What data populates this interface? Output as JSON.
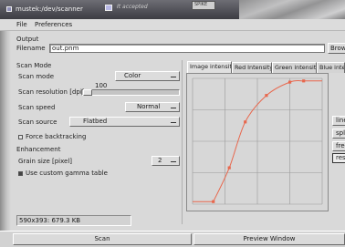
{
  "window": {
    "title": "mustek:/dev/scanner",
    "background_text": "It accepted",
    "background_card": "SPIKE"
  },
  "menu": [
    "File",
    "Preferences"
  ],
  "output": {
    "section": "Output",
    "filename_label": "Filename",
    "filename_value": "out.pnm",
    "browse_label": "Browse"
  },
  "scan_mode": {
    "section": "Scan Mode",
    "mode_label": "Scan mode",
    "mode_value": "Color",
    "resolution_label": "Scan resolution [dpi]",
    "resolution_value": "100",
    "speed_label": "Scan speed",
    "speed_value": "Normal",
    "source_label": "Scan source",
    "source_value": "Flatbed",
    "force_backtracking_label": "Force backtracking",
    "force_backtracking_checked": false
  },
  "enhancement": {
    "section": "Enhancement",
    "grain_label": "Grain size [pixel]",
    "grain_value": "2",
    "gamma_label": "Use custom gamma table",
    "gamma_checked": true
  },
  "tabs": [
    {
      "label": "Image intensity",
      "active": true
    },
    {
      "label": "Red Intensity",
      "active": false
    },
    {
      "label": "Green intensity",
      "active": false
    },
    {
      "label": "Blue intensity",
      "active": false
    }
  ],
  "curve_controls": [
    {
      "label": "linear",
      "selected": false
    },
    {
      "label": "spline",
      "selected": false
    },
    {
      "label": "free",
      "selected": false
    },
    {
      "label": "reset",
      "selected": true
    }
  ],
  "status": {
    "info": "590x393: 679.3 KB"
  },
  "actions": {
    "scan_label": "Scan",
    "preview_label": "Preview Window"
  },
  "colors": {
    "curve": "#e8674d",
    "grid": "#9a9a9a"
  },
  "gamma_curve": {
    "points": [
      [
        0.0,
        0.0
      ],
      [
        0.15,
        0.28
      ],
      [
        0.3,
        0.66
      ],
      [
        0.5,
        0.88
      ],
      [
        0.72,
        0.99
      ],
      [
        0.85,
        1.0
      ]
    ]
  }
}
